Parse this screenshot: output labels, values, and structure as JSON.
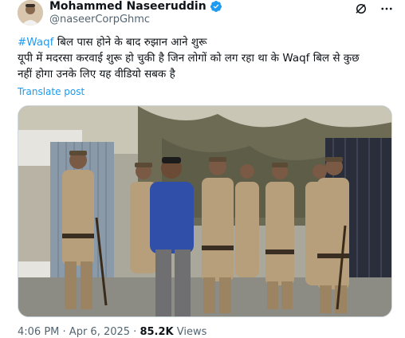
{
  "author": {
    "display_name": "Mohammed Naseeruddin",
    "handle": "@naseerCorpGhmc",
    "verified": true,
    "avatar_icon": "profile-photo"
  },
  "actions": {
    "grok_icon": "grok-icon",
    "more_icon": "more-options-icon"
  },
  "tweet": {
    "hashtag": "#Waqf",
    "line1_rest": " बिल पास होने के बाद रुझान आने शुरू",
    "line2": "यूपी में मदरसा करवाई शुरू हो चुकी है जिन लोगों को लग रहा था के Waqf बिल से कुछ",
    "line3": "नहीं होगा उनके लिए यह वीडियो सबक है"
  },
  "translate_label": "Translate post",
  "meta": {
    "time": "4:06 PM",
    "separator": " · ",
    "date": "Apr 6, 2025",
    "views_count": "85.2K",
    "views_label": " Views"
  },
  "colors": {
    "link": "#1d9bf0",
    "secondary_text": "#536471",
    "primary_text": "#0f1419",
    "verified_badge": "#1d9bf0"
  }
}
